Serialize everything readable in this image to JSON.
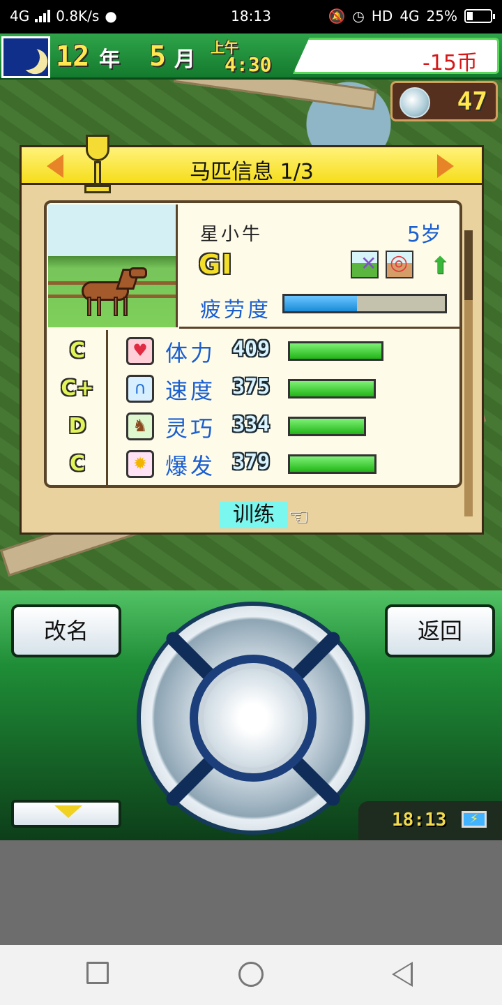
{
  "status_bar": {
    "network": "4G",
    "speed": "0.8K/s",
    "time": "18:13",
    "hd_label": "HD",
    "right_network": "4G",
    "battery": "25%"
  },
  "hud": {
    "year_value": "12",
    "year_label": "年",
    "month_value": "5",
    "month_label": "月",
    "am_pm": "上午",
    "clock": "4:30",
    "money": "-15币",
    "medals": "47"
  },
  "panel": {
    "title": "马匹信息 1/3",
    "horse": {
      "name": "星小牛",
      "age": "5岁",
      "grade": "GI",
      "fatigue_label": "疲劳度",
      "fatigue_level": 0.45
    },
    "stats": [
      {
        "grade": "C",
        "icon": "heart-icon",
        "label": "体力",
        "value": "409"
      },
      {
        "grade": "C+",
        "icon": "horseshoe-icon",
        "label": "速度",
        "value": "375"
      },
      {
        "grade": "D",
        "icon": "horse-icon",
        "label": "灵巧",
        "value": "334"
      },
      {
        "grade": "C",
        "icon": "burst-icon",
        "label": "爆发",
        "value": "379"
      }
    ],
    "train_button": "训练"
  },
  "controls": {
    "rename": "改名",
    "back": "返回",
    "game_clock": "18:13"
  },
  "colors": {
    "stat_label": "#1a5fd0",
    "money": "#d51717",
    "accent_green": "#21b516"
  }
}
